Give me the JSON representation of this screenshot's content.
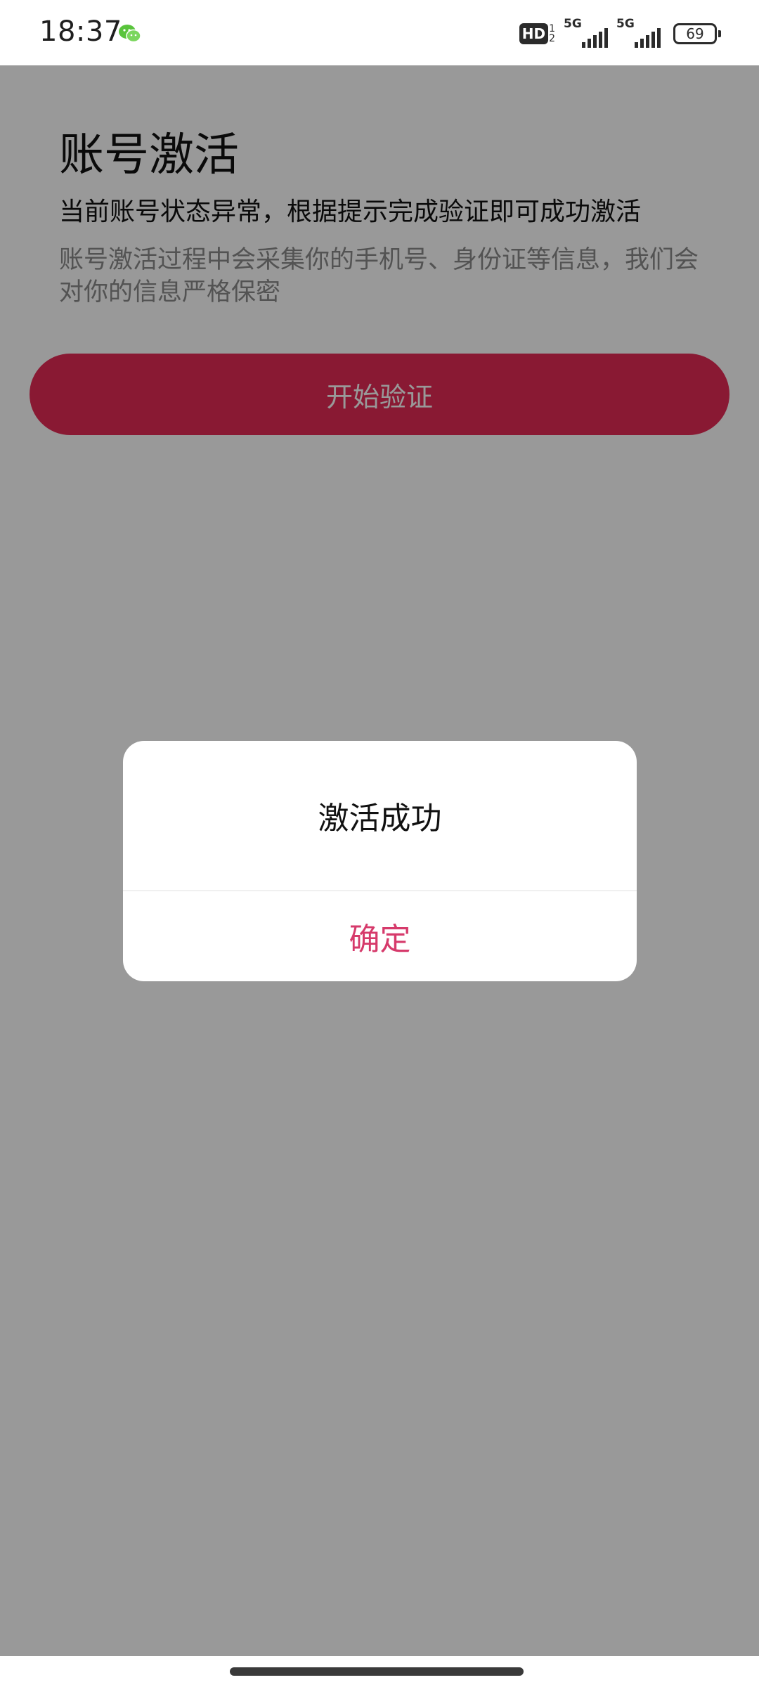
{
  "status_bar": {
    "time": "18:37",
    "hd_label": "HD",
    "hd_sub_top": "1",
    "hd_sub_bottom": "2",
    "network1": "5G",
    "network2": "5G",
    "battery": "69",
    "notification_icon": "wechat-icon"
  },
  "page": {
    "title": "账号激活",
    "description": "当前账号状态异常，根据提示完成验证即可成功激活",
    "note": "账号激活过程中会采集你的手机号、身份证等信息，我们会对你的信息严格保密",
    "start_button_label": "开始验证"
  },
  "dialog": {
    "message": "激活成功",
    "confirm_label": "确定"
  },
  "colors": {
    "accent": "#e52b55",
    "confirm_text": "#d63a6b"
  }
}
